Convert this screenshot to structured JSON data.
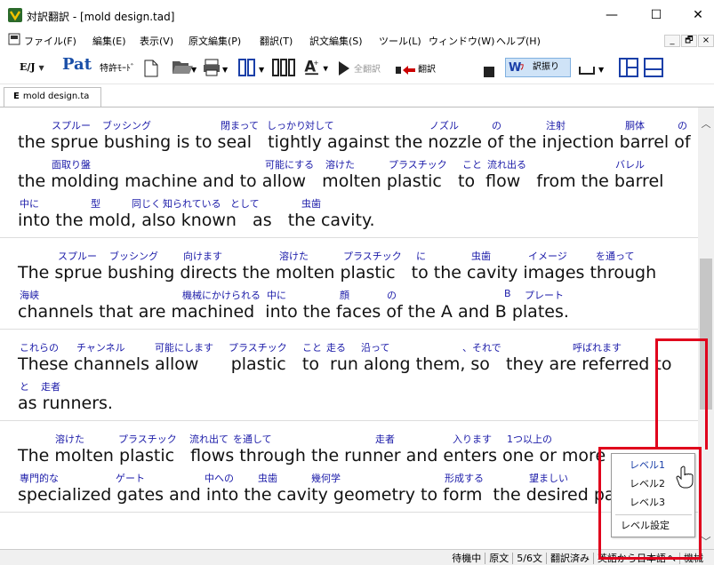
{
  "window": {
    "title": "対訳翻訳 - [mold design.tad]",
    "minimize": "—",
    "maximize": "☐",
    "close": "✕"
  },
  "menus": [
    "ファイル(F)",
    "編集(E)",
    "表示(V)",
    "原文編集(P)",
    "翻訳(T)",
    "訳文編集(S)",
    "ツール(L)",
    "ウィンドウ(W)",
    "ヘルプ(H)"
  ],
  "mdi_buttons": [
    "_",
    "🗗",
    "×"
  ],
  "toolbar": {
    "ej_label": "E/J",
    "pat_label": "Pat",
    "patent_mode": "特許ﾓｰﾄﾞ",
    "translate_all": "全翻訳",
    "translate": "翻訳",
    "furigana": "訳振り"
  },
  "doc_tab": {
    "letter": "E",
    "name": "mold design.ta"
  },
  "segments": [
    {
      "lines": [
        {
          "ja": [
            [
              "スプルー",
              58
            ],
            [
              "ブッシング",
              115
            ],
            [
              "閉まって",
              248
            ],
            [
              "しっかり",
              300
            ],
            [
              "対して",
              343
            ],
            [
              "ノズル",
              483
            ],
            [
              "の",
              553
            ],
            [
              "注射",
              614
            ],
            [
              "胴体",
              703
            ],
            [
              "の",
              762
            ]
          ],
          "en": "the sprue bushing is to seal   tightly against the nozzle of the injection barrel of"
        },
        {
          "ja": [
            [
              "面取り盤",
              58
            ],
            [
              "可能にする",
              298
            ],
            [
              "溶けた",
              366
            ],
            [
              "プラスチック",
              437
            ],
            [
              "こと",
              520
            ],
            [
              "流れ出る",
              548
            ],
            [
              "バレル",
              692
            ]
          ],
          "en": "the molding machine and to allow   molten plastic   to  flow   from the barrel"
        },
        {
          "ja": [
            [
              "中に",
              22
            ],
            [
              "型",
              102
            ],
            [
              "同じく",
              148
            ],
            [
              "知られている",
              183
            ],
            [
              "として",
              259
            ],
            [
              "虫歯",
              339
            ]
          ],
          "en": "into the mold, also known   as   the cavity."
        }
      ]
    },
    {
      "lines": [
        {
          "ja": [
            [
              "スプルー",
              65
            ],
            [
              "ブッシング",
              123
            ],
            [
              "向けます",
              206
            ],
            [
              "溶けた",
              314
            ],
            [
              "プラスチック",
              386
            ],
            [
              "に",
              468
            ],
            [
              "虫歯",
              530
            ],
            [
              "イメージ",
              594
            ],
            [
              "を通って",
              670
            ]
          ],
          "en": "The sprue bushing directs the molten plastic   to the cavity images through"
        },
        {
          "ja": [
            [
              "海峡",
              22
            ],
            [
              "機械にかけられる",
              205
            ],
            [
              "中に",
              300
            ],
            [
              "顔",
              382
            ],
            [
              "の",
              435
            ],
            [
              "B",
              567
            ],
            [
              "プレート",
              590
            ]
          ],
          "en": "channels that are machined  into the faces of the A and B plates."
        }
      ]
    },
    {
      "lines": [
        {
          "ja": [
            [
              "これらの",
              22
            ],
            [
              "チャンネル",
              86
            ],
            [
              "可能にします",
              174
            ],
            [
              "プラスチック",
              257
            ],
            [
              "こと",
              340
            ],
            [
              "走る",
              367
            ],
            [
              "沿って",
              406
            ],
            [
              "、それで",
              520
            ],
            [
              "呼ばれます",
              644
            ]
          ],
          "en": "These channels allow      plastic   to  run along them, so   they are referred to"
        },
        {
          "ja": [
            [
              "と",
              22
            ],
            [
              "走者",
              46
            ]
          ],
          "en": "as runners."
        }
      ]
    },
    {
      "lines": [
        {
          "ja": [
            [
              "溶けた",
              62
            ],
            [
              "プラスチック",
              133
            ],
            [
              "流れ出て",
              213
            ],
            [
              "を通して",
              262
            ],
            [
              "走者",
              422
            ],
            [
              "入ります",
              509
            ],
            [
              "1つ以上の",
              570
            ]
          ],
          "en": "The molten plastic   flows through the runner and enters one or more"
        },
        {
          "ja": [
            [
              "専門的な",
              22
            ],
            [
              "ゲート",
              130
            ],
            [
              "中への",
              230
            ],
            [
              "虫歯",
              290
            ],
            [
              "幾何学",
              350
            ],
            [
              "形成する",
              500
            ],
            [
              "望ましい",
              595
            ]
          ],
          "en": "specialized gates and into the cavity geometry to form  the desired part"
        }
      ]
    }
  ],
  "popup_menu": [
    "レベル1",
    "レベル2",
    "レベル3",
    "レベル設定"
  ],
  "status": [
    "待機中",
    "原文",
    "5/6文",
    "翻訳済み",
    "英語から日本語へ",
    "機械"
  ],
  "colors": {
    "annotation": "#1a1aa8",
    "highlight": "#e0001c"
  }
}
